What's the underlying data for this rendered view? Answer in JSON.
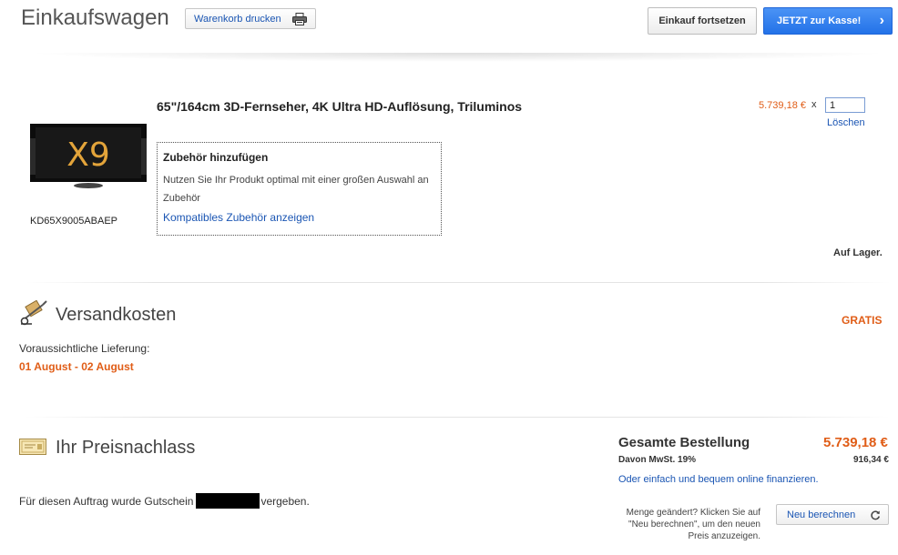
{
  "header": {
    "title": "Einkaufswagen",
    "print_label": "Warenkorb drucken",
    "continue_label": "Einkauf fortsetzen",
    "checkout_label": "JETZT zur Kasse!"
  },
  "product": {
    "name": "65\"/164cm 3D-Fernseher, 4K Ultra HD-Auflösung, Triluminos",
    "image_text": "X9",
    "sku": "KD65X9005ABAEP",
    "price": "5.739,18 €",
    "times": "x",
    "quantity": "1",
    "delete_label": "Löschen",
    "stock": "Auf Lager.",
    "accessories": {
      "title": "Zubehör hinzufügen",
      "text": "Nutzen Sie Ihr Produkt optimal mit einer großen Auswahl an Zubehör",
      "link": "Kompatibles Zubehör anzeigen"
    }
  },
  "shipping": {
    "title": "Versandkosten",
    "cost": "GRATIS",
    "delivery_label": "Voraussichtliche Lieferung:",
    "delivery_dates": "01 August - 02 August"
  },
  "discount": {
    "title": "Ihr Preisnachlass",
    "text_before": "Für diesen Auftrag wurde Gutschein",
    "text_after": "vergeben."
  },
  "totals": {
    "label": "Gesamte Bestellung",
    "value": "5.739,18 €",
    "vat_label": "Davon MwSt. 19%",
    "vat_value": "916,34 €",
    "finance_link": "Oder einfach und bequem online finanzieren.",
    "recalc_note": "Menge geändert? Klicken Sie auf \"Neu berechnen\", um den neuen Preis anzuzeigen.",
    "recalc_label": "Neu berechnen"
  },
  "colors": {
    "accent": "#e05d17",
    "link": "#1a55b3",
    "primary_button": "#2372e8"
  }
}
